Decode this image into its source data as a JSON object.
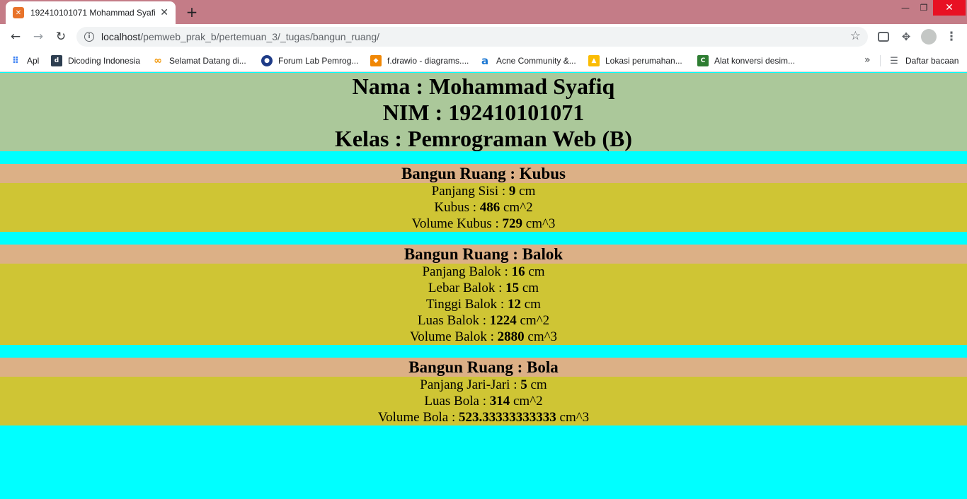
{
  "browser": {
    "tab_title": "192410101071 Mohammad Syafiq",
    "url_host": "localhost",
    "url_path": "/pemweb_prak_b/pertemuan_3/_tugas/bangun_ruang/",
    "bookmarks": [
      {
        "label": "Apl",
        "icon": "apps-grid-icon",
        "color": "#4285f4"
      },
      {
        "label": "Dicoding Indonesia",
        "icon": "dicoding-icon",
        "color": "#2d3e50"
      },
      {
        "label": "Selamat Datang di...",
        "icon": "infinity-icon",
        "color": "#f29400"
      },
      {
        "label": "Forum Lab Pemrog...",
        "icon": "forum-logo-icon",
        "color": "#1f3c88"
      },
      {
        "label": "f.drawio - diagrams....",
        "icon": "drawio-icon",
        "color": "#f08705"
      },
      {
        "label": "Acne Community &...",
        "icon": "acne-icon",
        "color": "#1976d2"
      },
      {
        "label": "Lokasi perumahan...",
        "icon": "maps-icon",
        "color": "#fbbc04"
      },
      {
        "label": "Alat konversi desim...",
        "icon": "converter-icon",
        "color": "#2e7d32"
      }
    ],
    "reading_list_label": "Daftar bacaan"
  },
  "header": {
    "nama": "Nama : Mohammad Syafiq",
    "nim": "NIM : 192410101071",
    "kelas": "Kelas : Pemrograman Web (B)"
  },
  "kubus": {
    "title": "Bangun Ruang : Kubus",
    "rows": [
      {
        "label": "Panjang Sisi : ",
        "value": "9",
        "unit": " cm"
      },
      {
        "label": "Kubus : ",
        "value": "486",
        "unit": " cm^2"
      },
      {
        "label": "Volume Kubus : ",
        "value": "729",
        "unit": " cm^3"
      }
    ]
  },
  "balok": {
    "title": "Bangun Ruang : Balok",
    "rows": [
      {
        "label": "Panjang Balok : ",
        "value": "16",
        "unit": " cm"
      },
      {
        "label": "Lebar Balok : ",
        "value": "15",
        "unit": " cm"
      },
      {
        "label": "Tinggi Balok : ",
        "value": "12",
        "unit": " cm"
      },
      {
        "label": "Luas Balok : ",
        "value": "1224",
        "unit": " cm^2"
      },
      {
        "label": "Volume Balok : ",
        "value": "2880",
        "unit": " cm^3"
      }
    ]
  },
  "bola": {
    "title": "Bangun Ruang : Bola",
    "rows": [
      {
        "label": "Panjang Jari-Jari : ",
        "value": "5",
        "unit": " cm"
      },
      {
        "label": "Luas Bola : ",
        "value": "314",
        "unit": " cm^2"
      },
      {
        "label": "Volume Bola : ",
        "value": "523.33333333333",
        "unit": " cm^3"
      }
    ]
  }
}
